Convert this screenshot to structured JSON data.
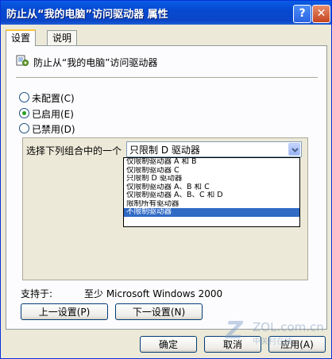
{
  "window": {
    "title": "防止从“我的电脑”访问驱动器 属性",
    "help_glyph": "?",
    "close_glyph": "✕"
  },
  "tabs": [
    {
      "label": "设置",
      "active": true
    },
    {
      "label": "说明",
      "active": false
    }
  ],
  "setting": {
    "policy_title": "防止从“我的电脑”访问驱动器",
    "options": [
      {
        "label": "未配置(C)",
        "checked": false
      },
      {
        "label": "已启用(E)",
        "checked": true
      },
      {
        "label": "已禁用(D)",
        "checked": false
      }
    ],
    "combo_label": "选择下列组合中的一个",
    "combo_value": "只限制 D 驱动器",
    "dropdown_options": [
      "仅限制驱动器 A 和 B",
      "仅限制驱动器 C",
      "只限制 D 驱动器",
      "仅限制驱动器 A、B 和 C",
      "仅限制驱动器 A、B、C 和 D",
      "限制所有驱动器",
      "不限制驱动器"
    ],
    "selected_index": 6,
    "support_label": "支持于:",
    "support_value": "至少 Microsoft Windows 2000"
  },
  "nav": {
    "prev_label": "上一设置(P)",
    "next_label": "下一设置(N)"
  },
  "footer": {
    "ok_label": "确定",
    "cancel_label": "取消",
    "apply_label": "应用(A)"
  },
  "watermark": {
    "logo": "Z",
    "site": "ZOL.com.cn",
    "name": "中关村在线"
  },
  "colors": {
    "titlebar": "#0a5ce5",
    "selection": "#316ac5",
    "checked": "#21a121"
  }
}
